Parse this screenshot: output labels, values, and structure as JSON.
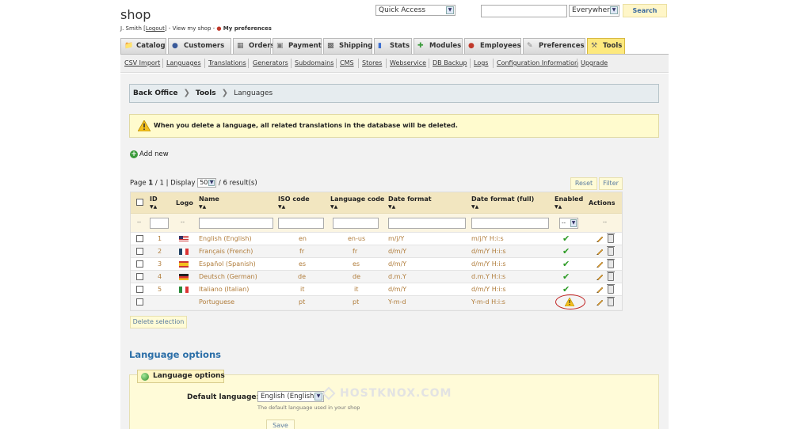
{
  "header": {
    "shop_title": "shop",
    "user_name": "J. Smith",
    "logout_label": "Logout",
    "view_shop_label": "View my shop",
    "my_prefs_label": "My preferences",
    "quick_access": "Quick Access",
    "search_value": "",
    "search_scope": "Everywhere",
    "search_button": "Search"
  },
  "tabs": [
    {
      "label": "Catalog",
      "icon": "catalog-icon"
    },
    {
      "label": "Customers",
      "icon": "customers-icon"
    },
    {
      "label": "Orders",
      "icon": "orders-icon"
    },
    {
      "label": "Payment",
      "icon": "payment-icon"
    },
    {
      "label": "Shipping",
      "icon": "shipping-icon"
    },
    {
      "label": "Stats",
      "icon": "stats-icon"
    },
    {
      "label": "Modules",
      "icon": "modules-icon"
    },
    {
      "label": "Employees",
      "icon": "employees-icon"
    },
    {
      "label": "Preferences",
      "icon": "preferences-icon"
    },
    {
      "label": "Tools",
      "icon": "tools-icon",
      "active": true
    }
  ],
  "subnav": [
    "CSV Import",
    "Languages",
    "Translations",
    "Generators",
    "Subdomains",
    "CMS",
    "Stores",
    "Webservice",
    "DB Backup",
    "Logs",
    "Configuration Information",
    "Upgrade"
  ],
  "breadcrumb": {
    "root": "Back Office",
    "section": "Tools",
    "current": "Languages"
  },
  "warning_text": "When you delete a language, all related translations in the database will be deleted.",
  "add_new_label": "Add new",
  "pager": {
    "page_label": "Page",
    "page": "1",
    "of": "/ 1 | Display",
    "display_count": "50",
    "results": "/ 6 result(s)"
  },
  "buttons": {
    "reset": "Reset",
    "filter": "Filter",
    "delete_selection": "Delete selection",
    "save": "Save"
  },
  "table": {
    "headers": {
      "id": "ID",
      "logo": "Logo",
      "name": "Name",
      "iso": "ISO code",
      "lang_code": "Language code",
      "date_format": "Date format",
      "date_format_full": "Date format (full)",
      "enabled": "Enabled",
      "actions": "Actions"
    },
    "enabled_filter": "--",
    "filter_dash": "--",
    "rows": [
      {
        "id": "1",
        "flag": "us",
        "name": "English (English)",
        "iso": "en",
        "code": "en-us",
        "date": "m/j/Y",
        "date_full": "m/j/Y H:i:s",
        "enabled": true
      },
      {
        "id": "2",
        "flag": "fr",
        "name": "Français (French)",
        "iso": "fr",
        "code": "fr",
        "date": "d/m/Y",
        "date_full": "d/m/Y H:i:s",
        "enabled": true
      },
      {
        "id": "3",
        "flag": "es",
        "name": "Español (Spanish)",
        "iso": "es",
        "code": "es",
        "date": "d/m/Y",
        "date_full": "d/m/Y H:i:s",
        "enabled": true
      },
      {
        "id": "4",
        "flag": "de",
        "name": "Deutsch (German)",
        "iso": "de",
        "code": "de",
        "date": "d.m.Y",
        "date_full": "d.m.Y H:i:s",
        "enabled": true
      },
      {
        "id": "5",
        "flag": "it",
        "name": "Italiano (Italian)",
        "iso": "it",
        "code": "it",
        "date": "d/m/Y",
        "date_full": "d/m/Y H:i:s",
        "enabled": true
      },
      {
        "id": "",
        "flag": "",
        "name": "Portuguese",
        "iso": "pt",
        "code": "pt",
        "date": "Y-m-d",
        "date_full": "Y-m-d H:i:s",
        "enabled": false
      }
    ]
  },
  "language_options": {
    "heading": "Language options",
    "legend": "Language options",
    "default_label": "Default language:",
    "default_value": "English (English)",
    "hint": "The default language used in your shop"
  },
  "watermark": "HOSTKNOX.COM",
  "colors": {
    "accent": "#2c6fa8",
    "warning_bg": "#fffbce",
    "active_tab": "#fde97e",
    "enabled_check": "#2a9a22",
    "highlight_oval": "#c02020"
  }
}
